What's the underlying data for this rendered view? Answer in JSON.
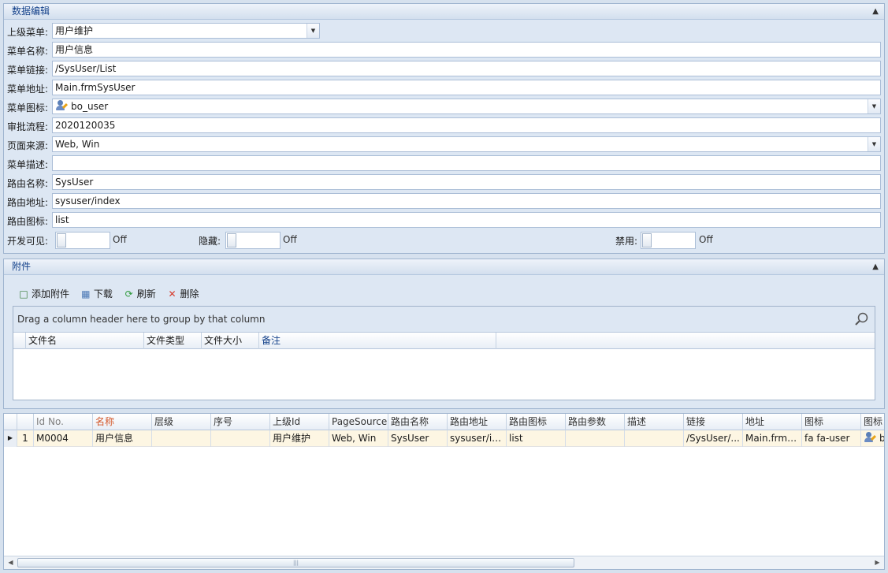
{
  "edit_group": {
    "title": "数据编辑",
    "fields": [
      {
        "label": "上级菜单:",
        "value": "用户维护"
      },
      {
        "label": "菜单名称:",
        "value": "用户信息"
      },
      {
        "label": "菜单链接:",
        "value": "/SysUser/List"
      },
      {
        "label": "菜单地址:",
        "value": "Main.frmSysUser"
      },
      {
        "label": "菜单图标:",
        "value": "bo_user"
      },
      {
        "label": "审批流程:",
        "value": "2020120035"
      },
      {
        "label": "页面来源:",
        "value": "Web, Win"
      },
      {
        "label": "菜单描述:",
        "value": ""
      },
      {
        "label": "路由名称:",
        "value": "SysUser"
      },
      {
        "label": "路由地址:",
        "value": "sysuser/index"
      },
      {
        "label": "路由图标:",
        "value": "list"
      }
    ],
    "toggles": [
      {
        "label": "开发可见:",
        "state": "Off"
      },
      {
        "label": "隐藏:",
        "state": "Off"
      },
      {
        "label": "禁用:",
        "state": "Off"
      }
    ]
  },
  "attach_group": {
    "title": "附件",
    "toolbar": {
      "add": "添加附件",
      "download": "下载",
      "refresh": "刷新",
      "delete": "删除"
    },
    "group_panel_text": "Drag a column header here to group by that column",
    "columns": [
      "文件名",
      "文件类型",
      "文件大小",
      "备注"
    ]
  },
  "main_grid": {
    "columns": [
      "Id No.",
      "名称",
      "层级",
      "序号",
      "上级Id",
      "PageSource",
      "路由名称",
      "路由地址",
      "路由图标",
      "路由参数",
      "描述",
      "链接",
      "地址",
      "图标",
      "图标"
    ],
    "row": {
      "num": "1",
      "cells": [
        "M0004",
        "用户信息",
        "",
        "",
        "用户维护",
        "Web, Win",
        "SysUser",
        "sysuser/in...",
        "list",
        "",
        "",
        "/SysUser/...",
        "Main.frmS...",
        "fa fa-user",
        "b"
      ]
    }
  },
  "colors": {
    "accent_header": "#15428b",
    "highlight_column": "#d4582a",
    "row_focus": "#fdf6e3"
  }
}
